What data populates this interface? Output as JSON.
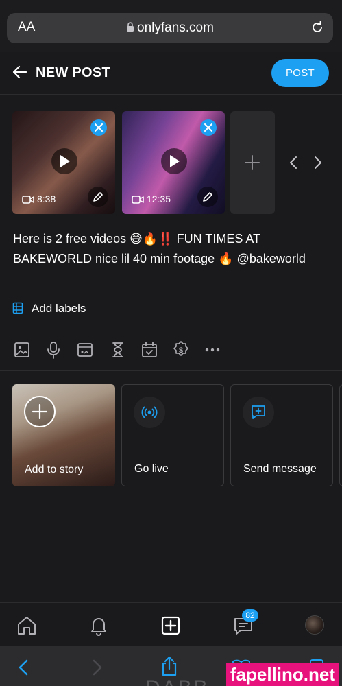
{
  "browser": {
    "aa_label": "AA",
    "url": "onlyfans.com"
  },
  "header": {
    "title": "NEW POST",
    "post_label": "POST"
  },
  "media": [
    {
      "duration": "8:38"
    },
    {
      "duration": "12:35"
    }
  ],
  "caption": "Here is 2 free videos 😅🔥‼️  FUN TIMES AT BAKEWORLD nice lil 40 min footage 🔥 @bakeworld",
  "labels": {
    "add_label": "Add labels"
  },
  "toolbar_icons": [
    "image-icon",
    "microphone-icon",
    "vault-icon",
    "hourglass-icon",
    "calendar-icon",
    "price-icon",
    "more-icon"
  ],
  "actions": {
    "story": "Add to story",
    "live": "Go live",
    "message": "Send message"
  },
  "tabbar": {
    "messages_badge": "82"
  },
  "watermark": "fapellino.net",
  "bg_text": "DABB",
  "colors": {
    "accent": "#1da0f2",
    "background": "#1a1a1c",
    "watermark": "#e8127c"
  }
}
